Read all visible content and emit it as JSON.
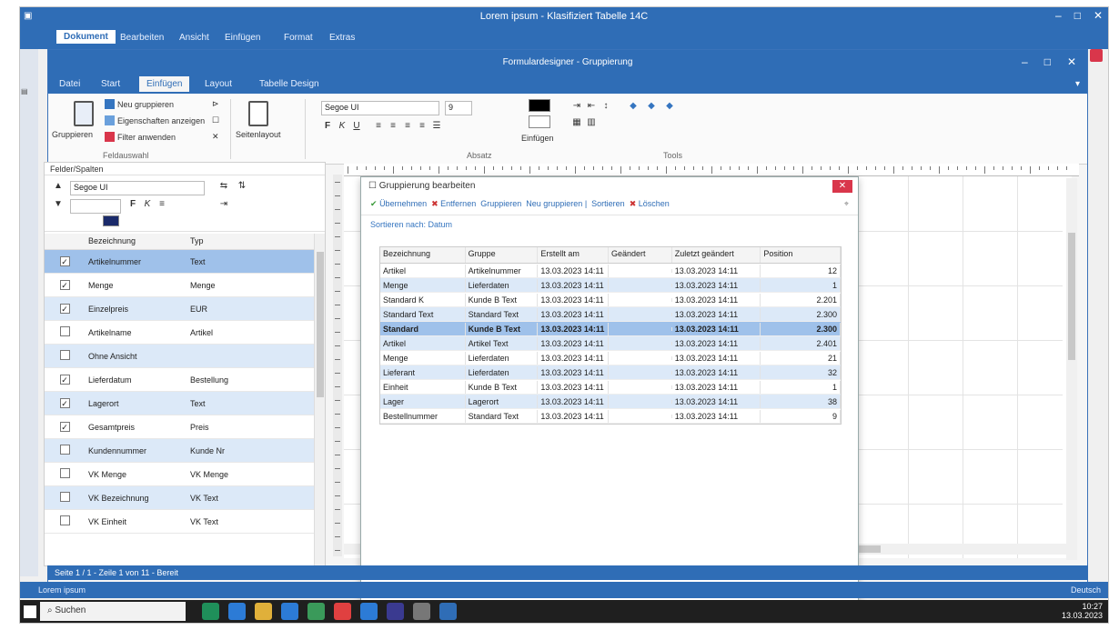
{
  "outer_window": {
    "title": "Lorem ipsum - Klasifiziert Tabelle 14C",
    "menu": [
      "Dokument",
      "Bearbeiten",
      "Ansicht",
      "Einfügen",
      "Format",
      "Extras"
    ],
    "win_buttons": [
      "–",
      "□",
      "✕"
    ]
  },
  "inner_window": {
    "title": "Formulardesigner - Gruppierung",
    "tabs": [
      "Datei",
      "Start",
      "Einfügen",
      "Layout",
      "Tabelle Design"
    ],
    "active_tab": 2
  },
  "ribbon": {
    "btn_group1": "Gruppieren",
    "btn_a": "Neu gruppieren",
    "btn_b": "Eigenschaften anzeigen",
    "btn_c": "Filter anwenden",
    "label_group": "Feldauswahl",
    "btn_big2": "Seitenlayout",
    "font_name": "Segoe UI",
    "font_size": "9",
    "group_font": "Absatz",
    "label_quick": "Einfügen",
    "group_tool": "Tools",
    "colors": {
      "fill": "#000000",
      "line": "#ffffff"
    }
  },
  "left_panel": {
    "title": "Felder/Spalten",
    "dropdown_value": "Segoe UI",
    "column_headers": [
      "Bezeichnung",
      "Typ"
    ],
    "rows": [
      {
        "checked": true,
        "name": "Artikelnummer",
        "type": "Text"
      },
      {
        "checked": true,
        "name": "Menge",
        "type": "Menge"
      },
      {
        "checked": true,
        "name": "Einzelpreis",
        "type": "EUR"
      },
      {
        "checked": false,
        "name": "Artikelname",
        "type": "Artikel"
      },
      {
        "checked": false,
        "name": "Ohne Ansicht",
        "type": ""
      },
      {
        "checked": true,
        "name": "Lieferdatum",
        "type": "Bestellung"
      },
      {
        "checked": true,
        "name": "Lagerort",
        "type": "Text"
      },
      {
        "checked": true,
        "name": "Gesamtpreis",
        "type": "Preis"
      },
      {
        "checked": false,
        "name": "Kundennummer",
        "type": "Kunde Nr"
      },
      {
        "checked": false,
        "name": "VK Menge",
        "type": "VK Menge"
      },
      {
        "checked": false,
        "name": "VK Bezeichnung",
        "type": "VK Text"
      },
      {
        "checked": false,
        "name": "VK Einheit",
        "type": "VK Text"
      }
    ]
  },
  "dialog": {
    "title": "Gruppierung bearbeiten",
    "toolbar": [
      "Übernehmen",
      "Entfernen",
      "Gruppieren",
      "Neu gruppieren",
      "Sortieren",
      "Löschen"
    ],
    "group_label": "Sortieren nach: Datum",
    "columns": [
      "Bezeichnung",
      "Gruppe",
      "Erstellt am",
      "Geändert",
      "Zuletzt geändert",
      "Position"
    ],
    "rows": [
      [
        "Artikel",
        "Artikelnummer",
        "13.03.2023 14:11",
        "",
        "13.03.2023 14:11",
        "12"
      ],
      [
        "Menge",
        "Lieferdaten",
        "13.03.2023 14:11",
        "",
        "13.03.2023 14:11",
        "1"
      ],
      [
        "Standard K",
        "Kunde B Text",
        "13.03.2023 14:11",
        "",
        "13.03.2023 14:11",
        "2.201"
      ],
      [
        "Standard Text",
        "Standard Text",
        "13.03.2023 14:11",
        "",
        "13.03.2023 14:11",
        "2.300"
      ],
      [
        "Standard",
        "Kunde B Text",
        "13.03.2023 14:11",
        "",
        "13.03.2023 14:11",
        "2.300"
      ],
      [
        "Artikel",
        "Artikel Text",
        "13.03.2023 14:11",
        "",
        "13.03.2023 14:11",
        "2.401"
      ],
      [
        "Menge",
        "Lieferdaten",
        "13.03.2023 14:11",
        "",
        "13.03.2023 14:11",
        "21"
      ],
      [
        "Lieferant",
        "Lieferdaten",
        "13.03.2023 14:11",
        "",
        "13.03.2023 14:11",
        "32"
      ],
      [
        "Einheit",
        "Kunde B Text",
        "13.03.2023 14:11",
        "",
        "13.03.2023 14:11",
        "1"
      ],
      [
        "Lager",
        "Lagerort",
        "13.03.2023 14:11",
        "",
        "13.03.2023 14:11",
        "38"
      ],
      [
        "Bestellnummer",
        "Standard Text",
        "13.03.2023 14:11",
        "",
        "13.03.2023 14:11",
        "9"
      ]
    ],
    "alt_rows": [
      1,
      3,
      5,
      7,
      9
    ],
    "selected_row": 4
  },
  "status_bar": "Seite 1 / 1 - Zeile 1 von 11 - Bereit",
  "app_status": {
    "left": "Lorem ipsum",
    "right": "Deutsch"
  },
  "taskbar": {
    "search": "Suchen",
    "time": "10:27",
    "date": "13.03.2023",
    "icon_colors": [
      "#1f8f5a",
      "#2c7bd6",
      "#e0b03a",
      "#2c7bd6",
      "#3a9a5a",
      "#e04040",
      "#2c7bd6",
      "#3a3a90",
      "#777777",
      "#2f6db6"
    ]
  }
}
